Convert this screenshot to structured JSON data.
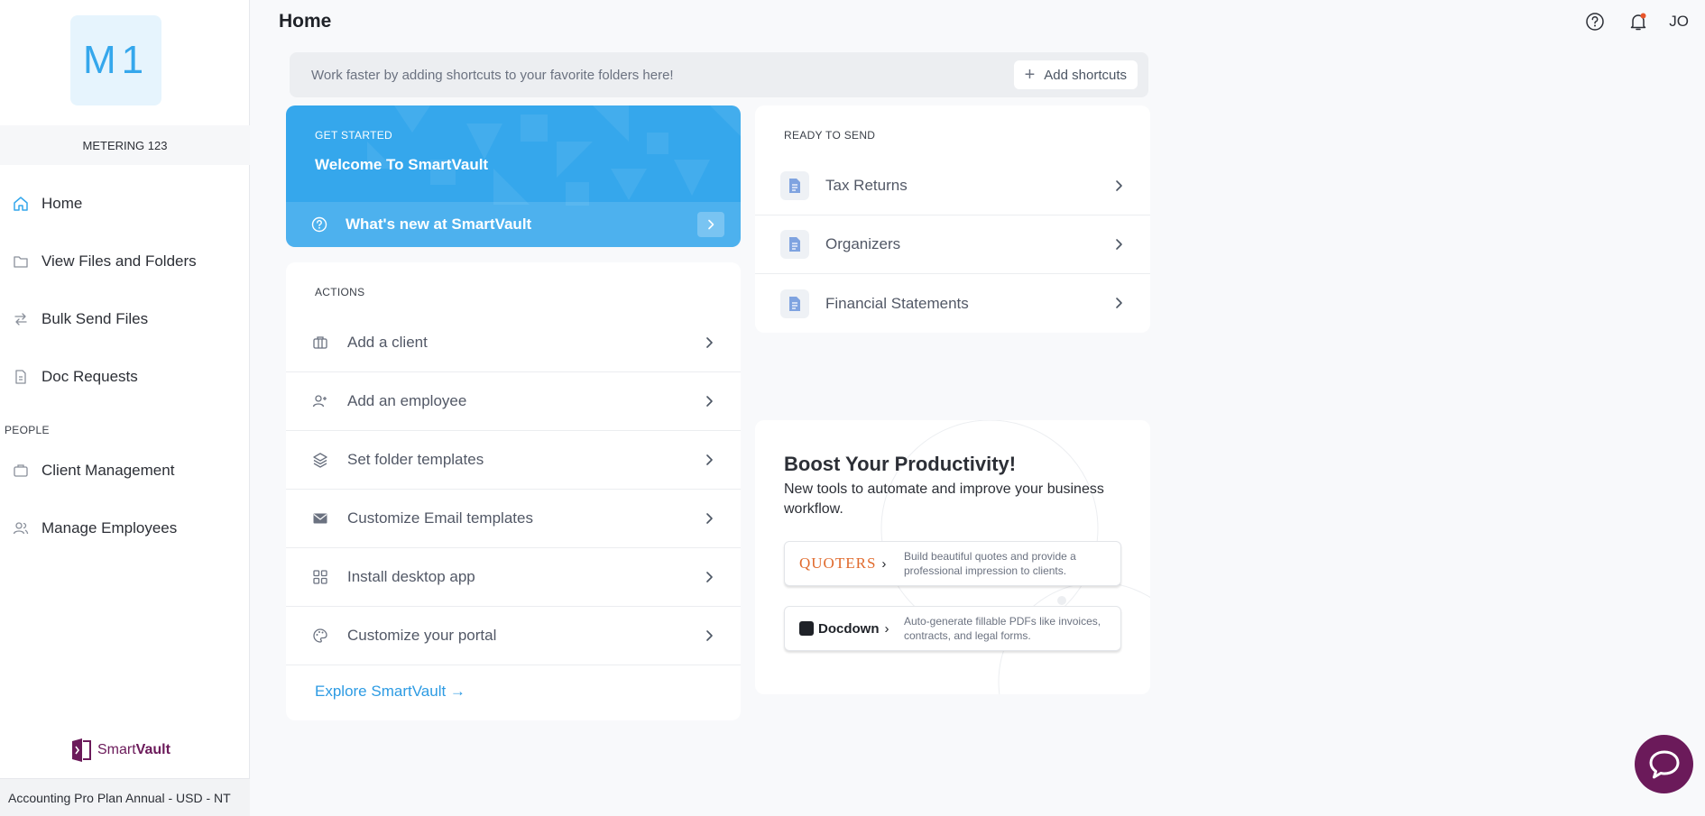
{
  "sidebar": {
    "org_initials": "M1",
    "org_name": "METERING 123",
    "nav": [
      {
        "label": "Home",
        "icon": "home-icon"
      },
      {
        "label": "View Files and Folders",
        "icon": "folder-icon"
      },
      {
        "label": "Bulk Send Files",
        "icon": "transfer-icon"
      },
      {
        "label": "Doc Requests",
        "icon": "document-icon"
      }
    ],
    "people_label": "PEOPLE",
    "people": [
      {
        "label": "Client Management",
        "icon": "briefcase-icon"
      },
      {
        "label": "Manage Employees",
        "icon": "users-icon"
      }
    ],
    "brand": {
      "prefix": "Smart",
      "suffix": "Vault"
    },
    "plan": "Accounting Pro Plan Annual - USD - NT"
  },
  "header": {
    "title": "Home",
    "user_initials": "JO"
  },
  "shortcuts": {
    "text": "Work faster by adding shortcuts to your favorite folders here!",
    "add_label": "Add shortcuts"
  },
  "get_started": {
    "eyebrow": "GET STARTED",
    "title": "Welcome To SmartVault",
    "link": "What's new at SmartVault"
  },
  "actions": {
    "eyebrow": "ACTIONS",
    "items": [
      {
        "label": "Add a client",
        "icon": "briefcase-icon"
      },
      {
        "label": "Add an employee",
        "icon": "add-user-icon"
      },
      {
        "label": "Set folder templates",
        "icon": "layers-icon"
      },
      {
        "label": "Customize Email templates",
        "icon": "mail-icon"
      },
      {
        "label": "Install desktop app",
        "icon": "grid-icon"
      },
      {
        "label": "Customize your portal",
        "icon": "palette-icon"
      }
    ],
    "explore": "Explore SmartVault →"
  },
  "ready_to_send": {
    "eyebrow": "READY TO SEND",
    "items": [
      {
        "label": "Tax Returns"
      },
      {
        "label": "Organizers"
      },
      {
        "label": "Financial Statements"
      }
    ]
  },
  "boost": {
    "title": "Boost Your Productivity!",
    "subtitle": "New tools to automate and improve your business workflow.",
    "promos": [
      {
        "name": "QUOTERS",
        "desc": "Build beautiful quotes and provide a professional impression to clients."
      },
      {
        "name": "Docdown",
        "desc": "Auto-generate fillable PDFs like invoices, contracts, and legal forms."
      }
    ]
  },
  "colors": {
    "accent": "#35a7ec",
    "brand": "#6b1a5a",
    "quoters": "#e06a2c"
  }
}
